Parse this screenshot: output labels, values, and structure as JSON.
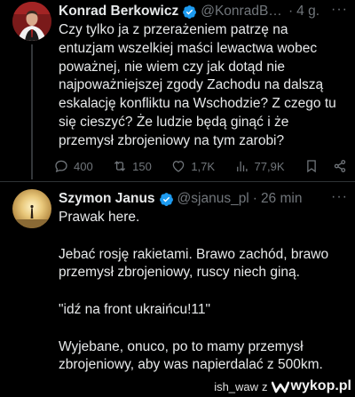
{
  "tweet1": {
    "name": "Konrad Berkowicz",
    "handle": "@KonradBer…",
    "time": "4 g.",
    "text": "Czy tylko ja z przerażeniem patrzę na entuzjam wszelkiej maści lewactwa wobec poważnej, nie wiem czy jak dotąd nie najpoważniejszej zgody Zachodu na dalszą eskalację konfliktu na Wschodzie? Z czego tu się cieszyć? Że ludzie będą ginąć i że przemysł zbrojeniowy na tym zarobi?",
    "actions": {
      "replies": "400",
      "reposts": "150",
      "likes": "1,7K",
      "views": "77,9K"
    }
  },
  "tweet2": {
    "name": "Szymon Janus",
    "handle": "@sjanus_pl",
    "time": "26 min",
    "paragraphs": [
      "Prawak here.",
      "Jebać rosję rakietami. Brawo zachód, brawo przemysł zbrojeniowy, ruscy niech giną.",
      "\"idź na front ukraińcu!11\"",
      "Wyjebane, onuco, po to mamy przemysł zbrojeniowy, aby was napierdalać z 500km."
    ]
  },
  "common": {
    "dot": "·",
    "more": "···"
  },
  "watermark": {
    "user": "ish_waw",
    "z": "z",
    "site": "wykop.pl"
  },
  "colors": {
    "verified": "#1d9bf0",
    "muted": "#71767b",
    "background": "#000000",
    "text": "#e7e9ea"
  },
  "icons": [
    "verified-badge-icon",
    "reply-icon",
    "repost-icon",
    "like-icon",
    "views-icon",
    "bookmark-icon",
    "share-icon",
    "more-icon",
    "wykop-logo-icon"
  ]
}
